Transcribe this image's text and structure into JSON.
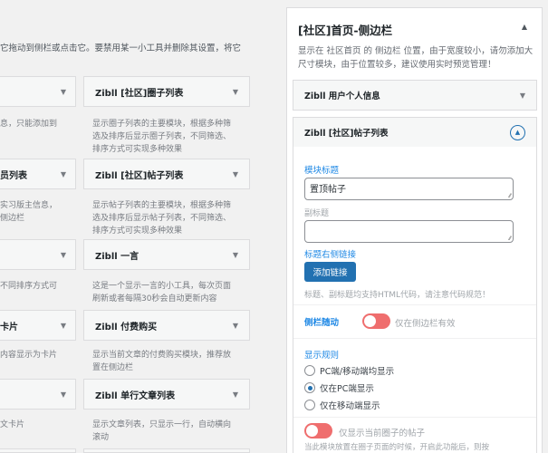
{
  "intro": "它拖动到侧栏或点击它。要禁用某一小工具并删除其设置，将它",
  "available_widgets": [
    {
      "title": "",
      "desc": "息，只能添加到"
    },
    {
      "title": "Zibll [社区]圈子列表",
      "desc": "显示圈子列表的主要模块，根据多种筛选及排序后显示圈子列表，不同筛选、排序方式可实现多种效果"
    },
    {
      "title": "员列表",
      "desc": "实习版主信息，侧边栏"
    },
    {
      "title": "Zibll [社区]帖子列表",
      "desc": "显示帖子列表的主要模块，根据多种筛选及排序后显示帖子列表，不同筛选、排序方式可实现多种效果"
    },
    {
      "title": "",
      "desc": "不同排序方式可"
    },
    {
      "title": "Zibll 一言",
      "desc": "这是一个显示一言的小工具，每次页面刷新或者每隔30秒会自动更新内容"
    },
    {
      "title": "卡片",
      "desc": "内容显示为卡片"
    },
    {
      "title": "Zibll 付费购买",
      "desc": "显示当前文章的付费购买模块，推荐放置在侧边栏"
    },
    {
      "title": "",
      "desc": "文卡片"
    },
    {
      "title": "Zibll 单行文章列表",
      "desc": "显示文章列表，只显示一行，自动横向滚动"
    }
  ],
  "sidebar": {
    "title": "[社区]首页-侧边栏",
    "desc": "显示在 社区首页 的 侧边栏 位置，由于宽度较小，请勿添加大尺寸模块，由于位置较多，建议使用实时预览管理！",
    "widget1": "Zibll 用户个人信息",
    "widget2": "Zibll [社区]帖子列表",
    "form": {
      "title_label": "模块标题",
      "title_value": "置顶帖子",
      "subtitle_label": "副标题",
      "subtitle_value": "",
      "link_label": "标题右侧链接",
      "add_link": "添加链接",
      "hint": "标题、副标题均支持HTML代码，请注意代码规范！",
      "follow_label": "侧栏随动",
      "follow_hint": "仅在侧边栏有效",
      "rule_label": "显示规则",
      "rules": [
        "PC端/移动端均显示",
        "仅在PC端显示",
        "仅在移动端显示"
      ],
      "rule_selected": 1,
      "only_current": "仅显示当前圈子的帖子",
      "only_current_desc": "当此模块放置在圈子页面的时候，开启此功能后，则按"
    }
  }
}
